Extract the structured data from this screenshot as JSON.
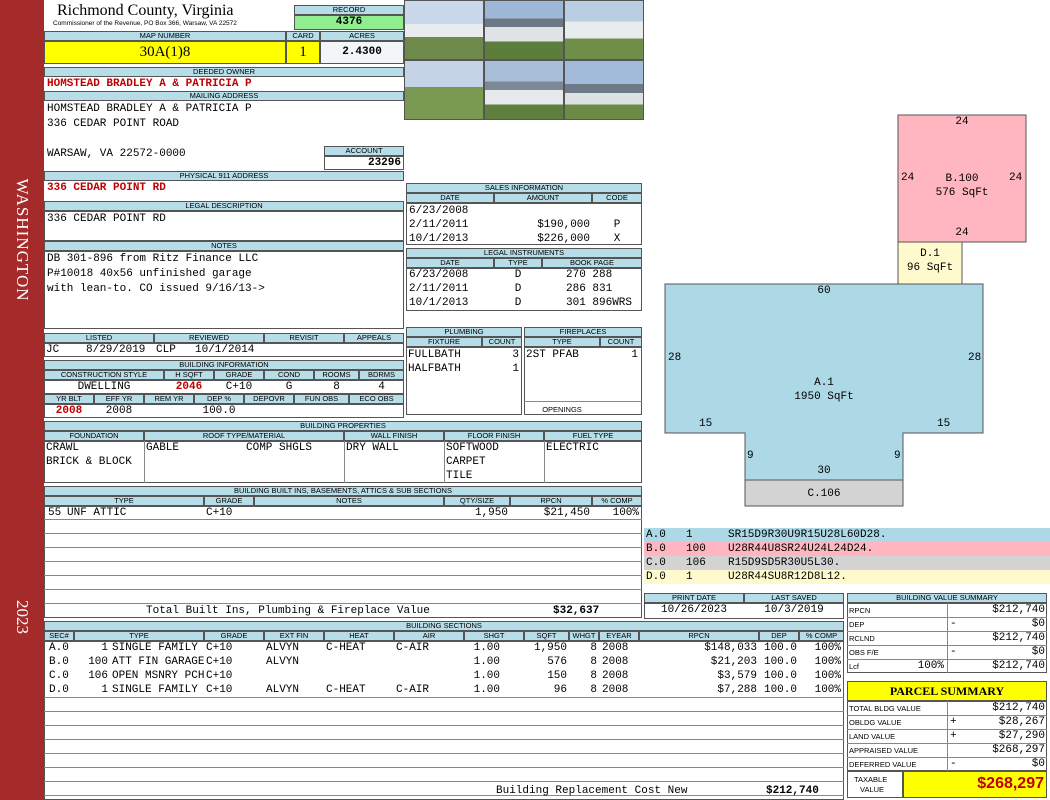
{
  "side_banner": {
    "city": "WASHINGTON",
    "year": "2023"
  },
  "header": {
    "county": "Richmond County, Virginia",
    "commissioner": "Commissioner of the Revenue, PO Box 366, Warsaw, VA 22572"
  },
  "record": {
    "label": "RECORD",
    "value": "4376"
  },
  "map_number": {
    "label": "MAP NUMBER",
    "value": "30A(1)8"
  },
  "card": {
    "label": "CARD",
    "value": "1"
  },
  "acres": {
    "label": "ACRES",
    "value": "2.4300"
  },
  "deeded_owner": {
    "label": "DEEDED OWNER",
    "value": "HOMSTEAD BRADLEY A & PATRICIA P"
  },
  "mailing": {
    "label": "MAILING ADDRESS",
    "line1": "HOMSTEAD BRADLEY A & PATRICIA P",
    "line2": "336 CEDAR POINT ROAD",
    "line3": "WARSAW, VA 22572-0000"
  },
  "account": {
    "label": "ACCOUNT",
    "value": "23296"
  },
  "physical": {
    "label": "PHYSICAL 911 ADDRESS",
    "value": "336 CEDAR POINT RD"
  },
  "legal": {
    "label": "LEGAL DESCRIPTION",
    "value": "336 CEDAR POINT RD"
  },
  "notes": {
    "label": "NOTES",
    "line1": "DB 301-896 from Ritz Finance LLC",
    "line2": "P#10018 40x56 unfinished garage",
    "line3": "with lean-to.  CO issued 9/16/13->"
  },
  "review": {
    "listed_label": "LISTED",
    "reviewed_label": "REVIEWED",
    "revisit_label": "REVISIT",
    "appeals_label": "APPEALS",
    "listed_by": "JC",
    "listed_date": "8/29/2019",
    "reviewed_by": "CLP",
    "reviewed_date": "10/1/2014"
  },
  "building_info": {
    "label": "BUILDING INFORMATION",
    "h_style": "CONSTRUCTION STYLE",
    "h_sqft": "H SQFT",
    "h_grade": "GRADE",
    "h_cond": "COND",
    "h_rooms": "ROOMS",
    "h_bdrms": "BDRMS",
    "style": "DWELLING",
    "sqft": "2046",
    "grade": "C+10",
    "cond": "G",
    "rooms": "8",
    "bdrms": "4",
    "h_yrblt": "YR BLT",
    "h_effyr": "EFF YR",
    "h_remyr": "REM YR",
    "h_dep": "DEP %",
    "h_depovr": "DEPOVR",
    "h_funobs": "FUN OBS",
    "h_ecoobs": "ECO OBS",
    "yrblt": "2008",
    "effyr": "2008",
    "dep": "100.0"
  },
  "properties": {
    "label": "BUILDING PROPERTIES",
    "h_foundation": "FOUNDATION",
    "h_roof": "ROOF TYPE/MATERIAL",
    "h_wall": "WALL FINISH",
    "h_floor": "FLOOR FINISH",
    "h_fuel": "FUEL TYPE",
    "foundation1": "CRAWL",
    "foundation2": "BRICK & BLOCK",
    "roof_type": "GABLE",
    "roof_mat": "COMP SHGLS",
    "wall": "DRY WALL",
    "floor1": "SOFTWOOD",
    "floor2": "CARPET",
    "floor3": "TILE",
    "fuel": "ELECTRIC"
  },
  "builtins": {
    "label": "BUILDING BUILT INS, BASEMENTS, ATTICS & SUB SECTIONS",
    "h_type": "TYPE",
    "h_grade": "GRADE",
    "h_notes": "NOTES",
    "h_qty": "QTY/SIZE",
    "h_rpcn": "RPCN",
    "h_comp": "% COMP",
    "row": {
      "code": "55",
      "type": "UNF ATTIC",
      "grade": "C+10",
      "qty": "1,950",
      "rpcn": "$21,450",
      "comp": "100%"
    },
    "total_label": "Total Built Ins, Plumbing & Fireplace Value",
    "total_value": "$32,637"
  },
  "sales": {
    "label": "SALES INFORMATION",
    "h_date": "DATE",
    "h_amount": "AMOUNT",
    "h_code": "CODE",
    "rows": [
      {
        "date": "6/23/2008",
        "amount": "",
        "code": ""
      },
      {
        "date": "2/11/2011",
        "amount": "$190,000",
        "code": "P"
      },
      {
        "date": "10/1/2013",
        "amount": "$226,000",
        "code": "X"
      }
    ]
  },
  "legal_instr": {
    "label": "LEGAL INSTRUMENTS",
    "h_date": "DATE",
    "h_type": "TYPE",
    "h_book": "BOOK PAGE",
    "rows": [
      {
        "date": "6/23/2008",
        "type": "D",
        "book": "270 288"
      },
      {
        "date": "2/11/2011",
        "type": "D",
        "book": "286 831"
      },
      {
        "date": "10/1/2013",
        "type": "D",
        "book": "301 896WRS"
      }
    ]
  },
  "plumbing": {
    "label": "PLUMBING",
    "h_fixture": "FIXTURE",
    "h_count": "COUNT",
    "rows": [
      {
        "fixture": "FULLBATH",
        "count": "3"
      },
      {
        "fixture": "HALFBATH",
        "count": "1"
      }
    ]
  },
  "fireplaces": {
    "label": "FIREPLACES",
    "h_type": "TYPE",
    "h_count": "COUNT",
    "rows": [
      {
        "type": "2ST PFAB",
        "count": "1"
      }
    ],
    "openings": "OPENINGS"
  },
  "sketch": {
    "a_label": "A.1",
    "a_area": "1950 SqFt",
    "b_label": "B.100",
    "b_area": "576 SqFt",
    "c_label": "C.106",
    "d_label": "D.1",
    "d_area": "96 SqFt",
    "dims": {
      "b_top": "24",
      "b_left": "24",
      "b_right": "24",
      "b_bottom": "24",
      "a_top": "60",
      "a_left": "28",
      "a_right": "28",
      "a_ll": "15",
      "a_lr": "15",
      "a_vl": "9",
      "a_vr": "9",
      "a_bottom": "30"
    },
    "colors": {
      "a": "#add8e6",
      "b": "#ffb6c1",
      "c": "#d3d3d3",
      "d": "#fffacd"
    }
  },
  "codes": [
    {
      "sec": "A.0",
      "num": "1",
      "code": "SR15D9R30U9R15U28L60D28.",
      "color": "#add8e6"
    },
    {
      "sec": "B.0",
      "num": "100",
      "code": "U28R44U8SR24U24L24D24.",
      "color": "#ffb6c1"
    },
    {
      "sec": "C.0",
      "num": "106",
      "code": "R15D9SD5R30U5L30.",
      "color": "#d3d3d3"
    },
    {
      "sec": "D.0",
      "num": "1",
      "code": "U28R44SU8R12D8L12.",
      "color": "#fffacd"
    }
  ],
  "print": {
    "date_label": "PRINT DATE",
    "saved_label": "LAST SAVED",
    "date": "10/26/2023",
    "saved": "10/3/2019"
  },
  "sections": {
    "label": "BUILDING SECTIONS",
    "h": [
      "SEC#",
      "TYPE",
      "GRADE",
      "EXT FIN",
      "HEAT",
      "AIR",
      "SHGT",
      "SQFT",
      "WHGT",
      "EYEAR",
      "RPCN",
      "DEP",
      "% COMP"
    ],
    "rows": [
      {
        "sec": "A.0",
        "num": "1",
        "type": "SINGLE FAMILY",
        "grade": "C+10",
        "ext": "ALVYN",
        "heat": "C-HEAT",
        "air": "C-AIR",
        "shgt": "1.00",
        "sqft": "1,950",
        "whgt": "8",
        "eyear": "2008",
        "rpcn": "$148,033",
        "dep": "100.0",
        "comp": "100%"
      },
      {
        "sec": "B.0",
        "num": "100",
        "type": "ATT FIN GARAGE",
        "grade": "C+10",
        "ext": "ALVYN",
        "heat": "",
        "air": "",
        "shgt": "1.00",
        "sqft": "576",
        "whgt": "8",
        "eyear": "2008",
        "rpcn": "$21,203",
        "dep": "100.0",
        "comp": "100%"
      },
      {
        "sec": "C.0",
        "num": "106",
        "type": "OPEN MSNRY PCH",
        "grade": "C+10",
        "ext": "",
        "heat": "",
        "air": "",
        "shgt": "1.00",
        "sqft": "150",
        "whgt": "8",
        "eyear": "2008",
        "rpcn": "$3,579",
        "dep": "100.0",
        "comp": "100%"
      },
      {
        "sec": "D.0",
        "num": "1",
        "type": "SINGLE FAMILY",
        "grade": "C+10",
        "ext": "ALVYN",
        "heat": "C-HEAT",
        "air": "C-AIR",
        "shgt": "1.00",
        "sqft": "96",
        "whgt": "8",
        "eyear": "2008",
        "rpcn": "$7,288",
        "dep": "100.0",
        "comp": "100%"
      }
    ],
    "total_label": "Building Replacement Cost New",
    "total_value": "$212,740"
  },
  "value_summary": {
    "label": "BUILDING VALUE SUMMARY",
    "rpcn_label": "RPCN",
    "rpcn": "$212,740",
    "dep_label": "DEP",
    "dep_sign": "-",
    "dep": "$0",
    "rclnd_label": "RCLND",
    "rclnd": "$212,740",
    "obs_label": "OBS F/E",
    "obs_sign": "-",
    "obs": "$0",
    "lcf_label": "Lcf",
    "lcf_pct": "100%",
    "lcf": "$212,740"
  },
  "parcel": {
    "label": "PARCEL SUMMARY",
    "bldg_label": "TOTAL BLDG VALUE",
    "bldg": "$212,740",
    "obldg_label": "OBLDG VALUE",
    "obldg_sign": "+",
    "obldg": "$28,267",
    "land_label": "LAND VALUE",
    "land_sign": "+",
    "land": "$27,290",
    "appraised_label": "APPRAISED VALUE",
    "appraised": "$268,297",
    "deferred_label": "DEFERRED VALUE",
    "deferred_sign": "-",
    "deferred": "$0",
    "taxable_label1": "TAXABLE",
    "taxable_label2": "VALUE",
    "taxable": "$268,297"
  }
}
